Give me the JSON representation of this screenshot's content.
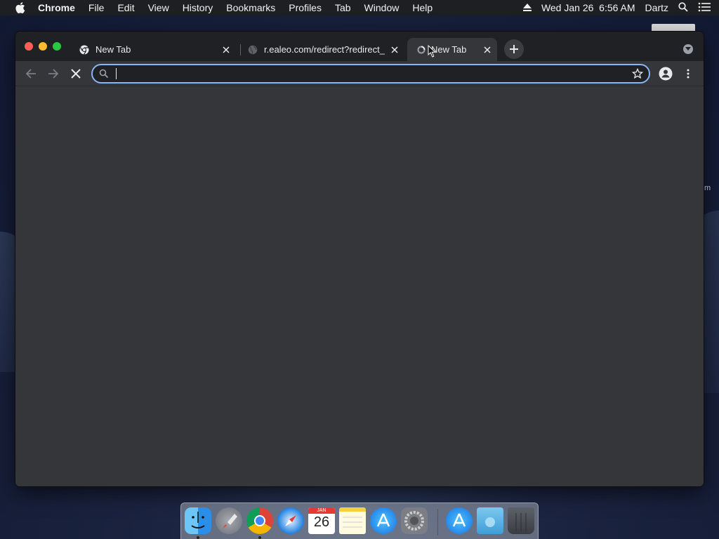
{
  "menubar": {
    "app_name": "Chrome",
    "items": [
      "File",
      "Edit",
      "View",
      "History",
      "Bookmarks",
      "Profiles",
      "Tab",
      "Window",
      "Help"
    ],
    "datetime": "Wed Jan 26  6:56 AM",
    "user": "Dartz"
  },
  "tabs": [
    {
      "title": "New Tab",
      "favicon": "chrome-icon",
      "active": false
    },
    {
      "title": "r.ealeo.com/redirect?redirect_i",
      "favicon": "globe-icon",
      "active": false
    },
    {
      "title": "New Tab",
      "favicon": "loading-icon",
      "active": true
    }
  ],
  "toolbar": {
    "omnibox_value": "",
    "omnibox_placeholder": ""
  },
  "desktop": {
    "partial_label": "m"
  },
  "dock": {
    "items": [
      "Finder",
      "Launchpad",
      "Google Chrome",
      "Safari",
      "Calendar",
      "Notes",
      "App Store",
      "System Preferences",
      "App Store",
      "Downloads",
      "Trash"
    ],
    "calendar_month": "JAN",
    "calendar_day": "26"
  },
  "colors": {
    "tabstrip": "#202124",
    "toolbar": "#35363a",
    "omnibox_focus": "#8ab4f8",
    "traffic_close": "#ff5f57",
    "traffic_min": "#febc2e",
    "traffic_max": "#28c840"
  }
}
